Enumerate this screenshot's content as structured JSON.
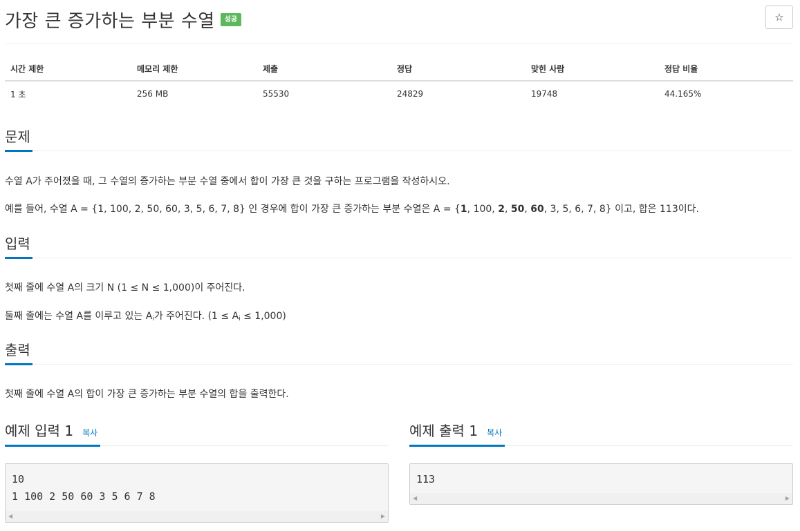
{
  "header": {
    "title": "가장 큰 증가하는 부분 수열",
    "badge": "성공",
    "star_icon": "☆"
  },
  "info_table": {
    "headers": [
      "시간 제한",
      "메모리 제한",
      "제출",
      "정답",
      "맞힌 사람",
      "정답 비율"
    ],
    "values": [
      "1 초",
      "256 MB",
      "55530",
      "24829",
      "19748",
      "44.165%"
    ]
  },
  "problem": {
    "heading": "문제",
    "line1": "수열 A가 주어졌을 때, 그 수열의 증가하는 부분 수열 중에서 합이 가장 큰 것을 구하는 프로그램을 작성하시오.",
    "line2_prefix": "예를 들어, 수열 A = {1, 100, 2, 50, 60, 3, 5, 6, 7, 8} 인 경우에 합이 가장 큰 증가하는 부분 수열은 A = {",
    "line2_b1": "1",
    "line2_s1": ", 100, ",
    "line2_b2": "2",
    "line2_s2": ", ",
    "line2_b3": "50",
    "line2_s3": ", ",
    "line2_b4": "60",
    "line2_suffix": ", 3, 5, 6, 7, 8} 이고, 합은 113이다."
  },
  "input": {
    "heading": "입력",
    "line1": "첫째 줄에 수열 A의 크기 N (1 ≤ N ≤ 1,000)이 주어진다.",
    "line2_a": "둘째 줄에는 수열 A를 이루고 있는 A",
    "line2_sub1": "i",
    "line2_b": "가 주어진다. (1 ≤ A",
    "line2_sub2": "i",
    "line2_c": " ≤ 1,000)"
  },
  "output": {
    "heading": "출력",
    "line1": "첫째 줄에 수열 A의 합이 가장 큰 증가하는 부분 수열의 합을 출력한다."
  },
  "sample_input": {
    "heading": "예제 입력 1",
    "copy_label": "복사",
    "lines": [
      "10",
      "1 100 2 50 60 3 5 6 7 8"
    ]
  },
  "sample_output": {
    "heading": "예제 출력 1",
    "copy_label": "복사",
    "lines": [
      "113"
    ]
  },
  "colors": {
    "accent": "#0076c0",
    "badge_success": "#5cb85c"
  }
}
